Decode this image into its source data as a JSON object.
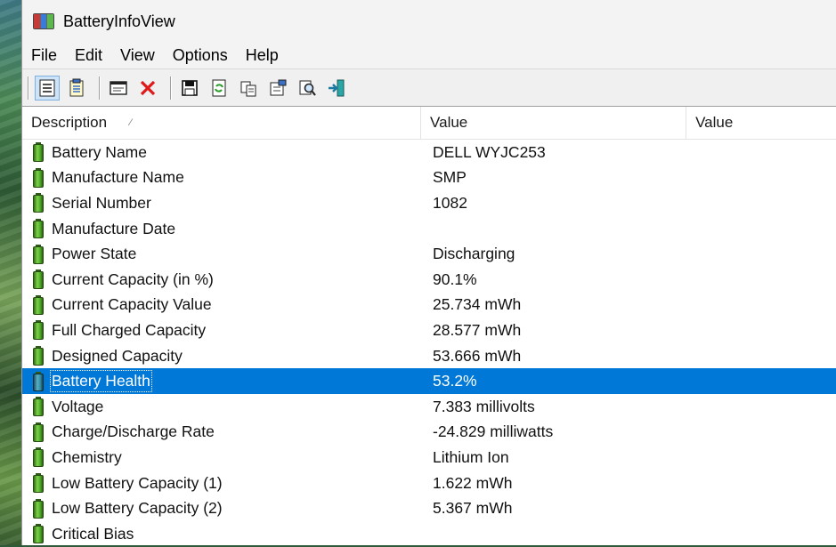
{
  "window": {
    "title": "BatteryInfoView"
  },
  "menu": [
    "File",
    "Edit",
    "View",
    "Options",
    "Help"
  ],
  "toolbar": {
    "buttons": [
      "properties-view-icon",
      "report-view-icon",
      "html-report-icon",
      "delete-icon",
      "save-icon",
      "refresh-icon",
      "copy-icon",
      "properties-icon",
      "find-icon",
      "exit-icon"
    ]
  },
  "columns": {
    "description": "Description",
    "value": "Value",
    "value2": "Value",
    "sort_indicator": "⁄"
  },
  "rows": [
    {
      "description": "Battery Name",
      "value": "DELL WYJC253"
    },
    {
      "description": "Manufacture Name",
      "value": "SMP"
    },
    {
      "description": "Serial Number",
      "value": "1082"
    },
    {
      "description": "Manufacture Date",
      "value": ""
    },
    {
      "description": "Power State",
      "value": "Discharging"
    },
    {
      "description": "Current Capacity (in %)",
      "value": "90.1%"
    },
    {
      "description": "Current Capacity Value",
      "value": "25.734 mWh"
    },
    {
      "description": "Full Charged Capacity",
      "value": "28.577 mWh"
    },
    {
      "description": "Designed Capacity",
      "value": "53.666 mWh"
    },
    {
      "description": "Battery Health",
      "value": "53.2%"
    },
    {
      "description": "Voltage",
      "value": "7.383 millivolts"
    },
    {
      "description": "Charge/Discharge Rate",
      "value": "-24.829 milliwatts"
    },
    {
      "description": "Chemistry",
      "value": "Lithium Ion"
    },
    {
      "description": "Low Battery Capacity (1)",
      "value": "1.622 mWh"
    },
    {
      "description": "Low Battery Capacity (2)",
      "value": "5.367 mWh"
    },
    {
      "description": "Critical Bias",
      "value": ""
    }
  ],
  "selected_row": "Battery Health",
  "colors": {
    "selection": "#0078d7",
    "battery_icon": "#4aa524"
  }
}
